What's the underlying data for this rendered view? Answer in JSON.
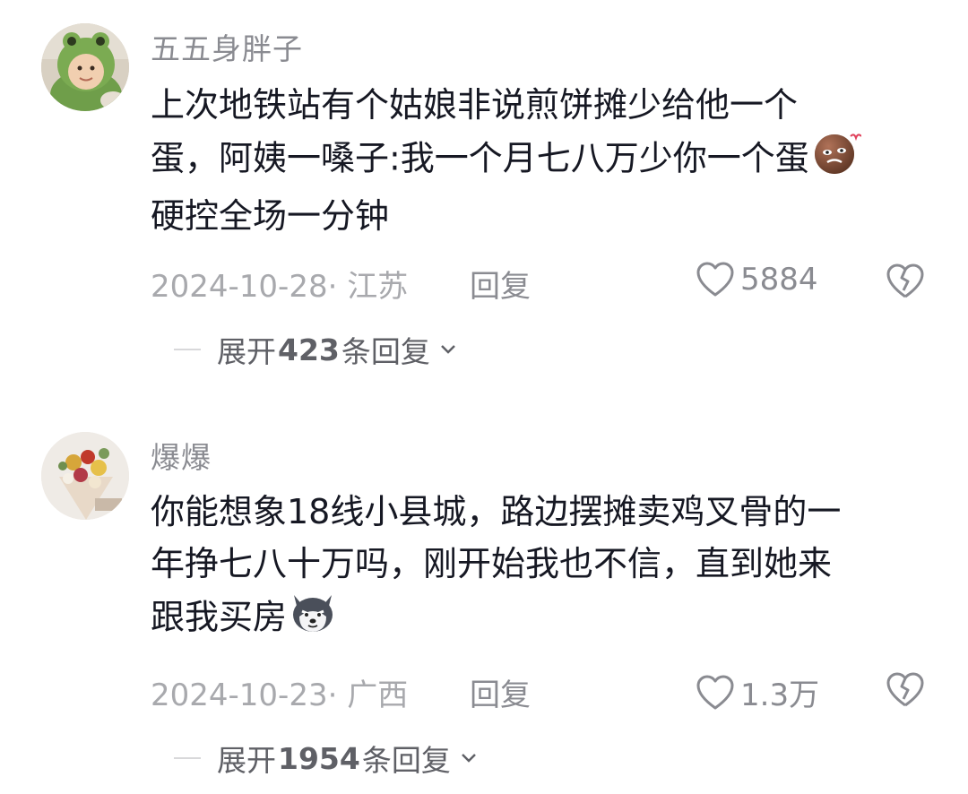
{
  "comments": [
    {
      "username": "五五身胖子",
      "text_lines": [
        "上次地铁站有个姑娘非说煎饼摊少给他一个",
        "蛋，阿姨一嗓子:我一个月七八万少你一个蛋",
        "硬控全场一分钟"
      ],
      "emoji": "embarrassed-face-emoji",
      "date_location": "2024-10-28· 江苏",
      "reply_label": "回复",
      "like_count": "5884",
      "expand": {
        "prefix": "展开",
        "count": "423",
        "suffix": "条回复"
      }
    },
    {
      "username": "爆爆",
      "text_lines": [
        "你能想象18线小县城，路边摆摊卖鸡叉骨的一",
        "年挣七八十万吗，刚开始我也不信，直到她来",
        "跟我买房"
      ],
      "emoji": "husky-dog-emoji",
      "date_location": "2024-10-23· 广西",
      "reply_label": "回复",
      "like_count": "1.3万",
      "expand": {
        "prefix": "展开",
        "count": "1954",
        "suffix": "条回复"
      }
    }
  ],
  "colors": {
    "text": "#161823",
    "muted": "#8a8b91",
    "date": "#a8a9ad",
    "expand": "#5f6066"
  }
}
